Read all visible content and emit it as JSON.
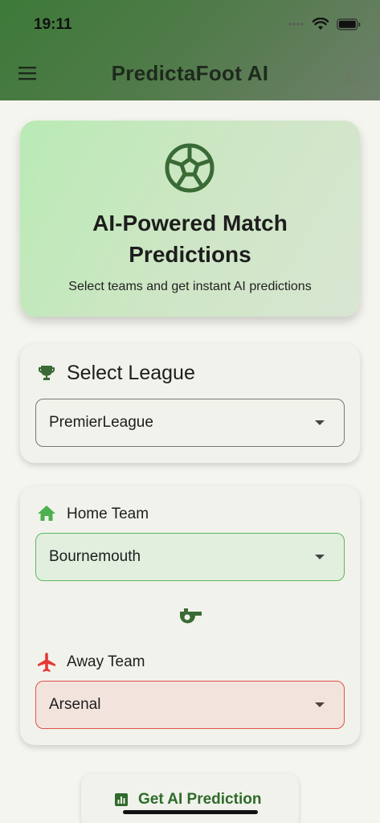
{
  "status_bar": {
    "time": "19:11"
  },
  "app_bar": {
    "title": "PredictaFoot AI"
  },
  "hero": {
    "title": "AI-Powered Match Predictions",
    "subtitle": "Select teams and get instant AI predictions"
  },
  "league": {
    "label": "Select League",
    "selected": "PremierLeague"
  },
  "teams": {
    "home_label": "Home Team",
    "home_selected": "Bournemouth",
    "away_label": "Away Team",
    "away_selected": "Arsenal"
  },
  "actions": {
    "predict_label": "Get AI Prediction"
  },
  "colors": {
    "header_green": "#3d7a39",
    "accent_green": "#2f6b2b",
    "home_border": "#5cb85a",
    "away_border": "#e0524a"
  },
  "icons": [
    "menu-icon",
    "refresh-icon",
    "soccer-ball-icon",
    "trophy-icon",
    "home-icon",
    "airplane-icon",
    "whistle-icon",
    "chart-icon",
    "wifi-icon",
    "battery-icon",
    "signal-icon"
  ]
}
